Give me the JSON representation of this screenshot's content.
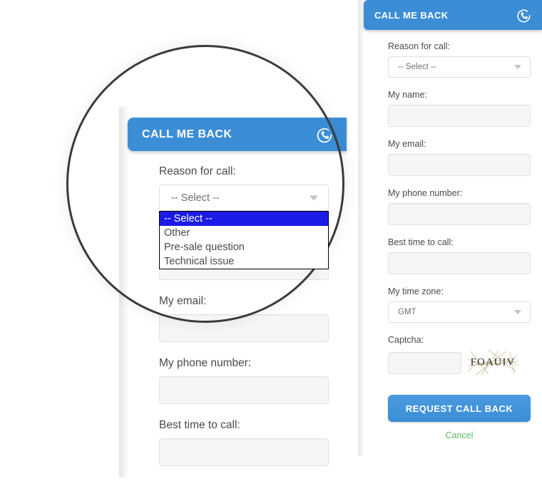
{
  "widget": {
    "header_title": "CALL ME BACK",
    "header_icon": "phone-callback-icon",
    "accent_color": "#3b8ed6",
    "cancel_color": "#5cb85c",
    "fields": {
      "reason": {
        "label": "Reason for call:",
        "value": "-- Select --",
        "options": [
          "-- Select --",
          "Other",
          "Pre-sale question",
          "Technical issue"
        ],
        "selected_index": 0
      },
      "name": {
        "label": "My name:",
        "value": ""
      },
      "email": {
        "label": "My email:",
        "value": ""
      },
      "phone": {
        "label": "My phone number:",
        "value": ""
      },
      "best_time": {
        "label": "Best time to call:",
        "value": ""
      },
      "time_zone": {
        "label": "My time zone:",
        "value": "GMT"
      },
      "captcha": {
        "label": "Captcha:",
        "value": "",
        "image_text": "FOAUIV"
      }
    },
    "submit_label": "REQUEST CALL BACK",
    "cancel_label": "Cancel"
  },
  "magnifier": {
    "header_title": "CALL ME BACK",
    "reason_label": "Reason for call:",
    "reason_value": "-- Select --",
    "reason_options": [
      "-- Select --",
      "Other",
      "Pre-sale question",
      "Technical issue"
    ],
    "email_label": "My email:",
    "phone_label": "My phone number:",
    "best_time_label": "Best time to call:"
  }
}
